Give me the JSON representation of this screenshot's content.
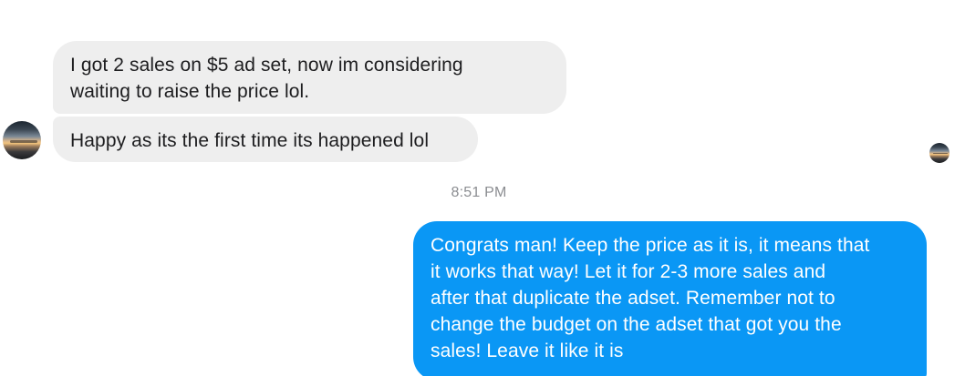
{
  "conversation": {
    "incoming": [
      {
        "lines": [
          "I got 2 sales on $5 ad set, now im considering",
          "waiting to raise the price lol."
        ]
      },
      {
        "lines": [
          "Happy as its the first time its happened lol"
        ]
      }
    ],
    "timestamp": "8:51 PM",
    "outgoing": {
      "lines": [
        "Congrats man! Keep the price as it is, it means that",
        "it works that way! Let it for 2-3 more sales and",
        "after that duplicate the adset. Remember not to",
        "change the budget on the adset that got you the",
        "sales! Leave it like it is"
      ]
    }
  },
  "colors": {
    "incoming_bubble": "#eeeeee",
    "incoming_text": "#1d1d1f",
    "outgoing_bubble": "#0a97f5",
    "outgoing_text": "#ffffff",
    "timestamp_text": "#8b8d91"
  },
  "icons": {
    "sender_avatar": "sunset-photo-avatar",
    "read_receipt": "sunset-photo-avatar-small"
  }
}
